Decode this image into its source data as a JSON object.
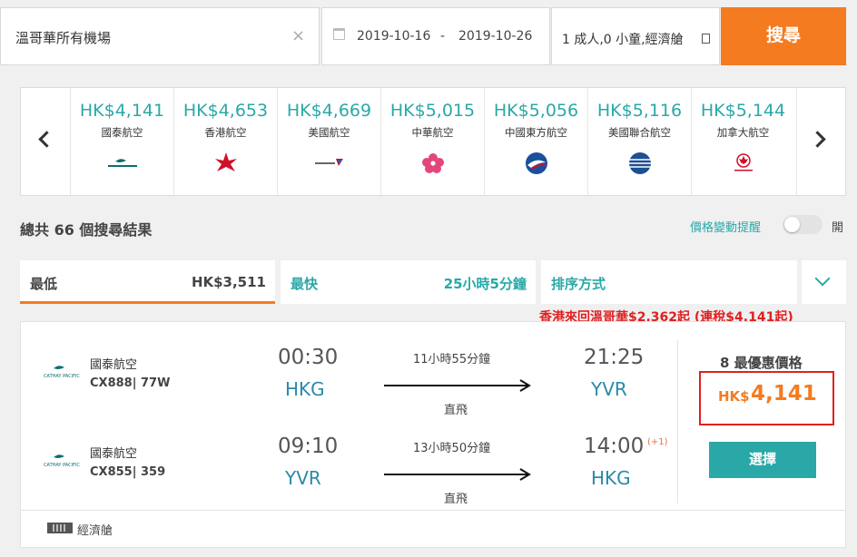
{
  "search": {
    "destination": "溫哥華所有機場",
    "clear_symbol": "×",
    "date_from": "2019-10-16",
    "date_sep": "-",
    "date_to": "2019-10-26",
    "passengers": "1 成人,0 小童,經濟艙",
    "search_label": "搜尋"
  },
  "carousel": {
    "airlines": [
      {
        "price": "HK$4,141",
        "name": "國泰航空",
        "logo": "cathay-pacific-logo"
      },
      {
        "price": "HK$4,653",
        "name": "香港航空",
        "logo": "hong-kong-airlines-logo"
      },
      {
        "price": "HK$4,669",
        "name": "美國航空",
        "logo": "american-airlines-logo"
      },
      {
        "price": "HK$5,015",
        "name": "中華航空",
        "logo": "china-airlines-logo"
      },
      {
        "price": "HK$5,056",
        "name": "中國東方航空",
        "logo": "china-eastern-logo"
      },
      {
        "price": "HK$5,116",
        "name": "美國聯合航空",
        "logo": "united-airlines-logo"
      },
      {
        "price": "HK$5,144",
        "name": "加拿大航空",
        "logo": "air-canada-logo"
      }
    ]
  },
  "results": {
    "total": "總共 66 個搜尋結果",
    "price_alert_label": "價格變動提醒",
    "toggle_text": "開"
  },
  "tabs": {
    "cheapest_label": "最低",
    "cheapest_value": "HK$3,511",
    "fastest_label": "最快",
    "fastest_value": "25小時5分鐘",
    "sort_label": "排序方式"
  },
  "promo": "香港來回溫哥華$2,362起 (連稅$4,141起)",
  "result": {
    "outbound": {
      "airline": "國泰航空",
      "flight": "CX888| 77W",
      "dep_time": "00:30",
      "dep_airport": "HKG",
      "duration": "11小時55分鐘",
      "stops": "直飛",
      "arr_time": "21:25",
      "arr_airport": "YVR"
    },
    "return": {
      "airline": "國泰航空",
      "flight": "CX855| 359",
      "dep_time": "09:10",
      "dep_airport": "YVR",
      "duration": "13小時50分鐘",
      "stops": "直飛",
      "arr_time": "14:00",
      "day_offset": "(+1)",
      "arr_airport": "HKG"
    },
    "price_title": "8 最優惠價格",
    "currency": "HK$",
    "amount": "4,141",
    "select_label": "選擇",
    "cabin": "經濟艙"
  },
  "colors": {
    "accent_orange": "#f47b20",
    "teal": "#2aa8a8",
    "highlight_red": "#e02020"
  }
}
